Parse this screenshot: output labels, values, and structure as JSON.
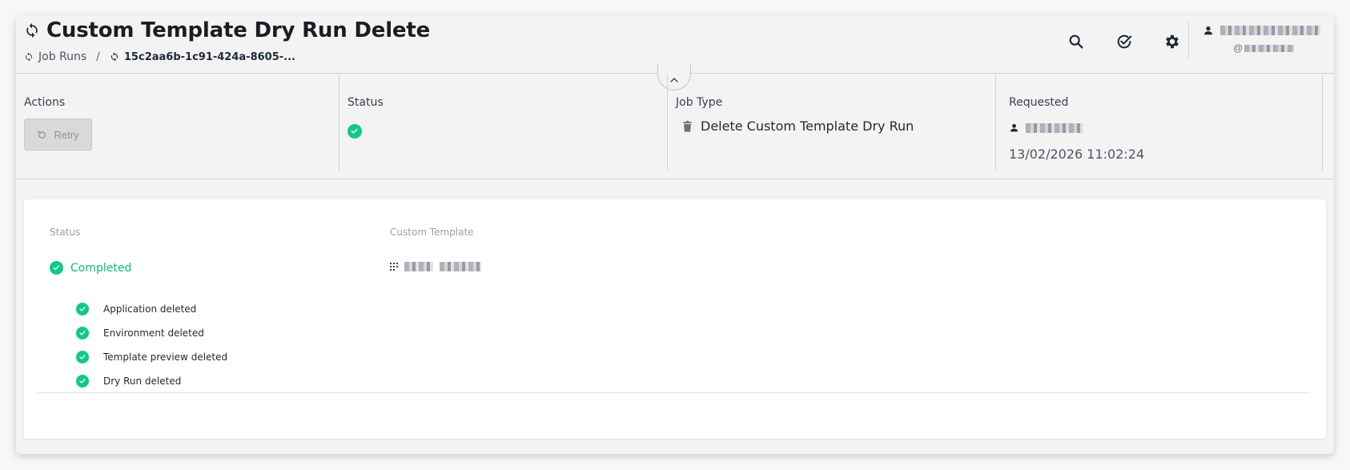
{
  "header": {
    "title": "Custom Template Dry Run Delete",
    "breadcrumb": [
      {
        "label": "Job Runs"
      },
      {
        "label": "15c2aa6b-1c91-424a-8605-..."
      }
    ],
    "separator": "/",
    "icons": [
      "sync-icon",
      "search-icon",
      "check-circle-icon",
      "gear-icon",
      "user-icon"
    ],
    "user_handle_prefix": "@"
  },
  "info": {
    "actions_label": "Actions",
    "retry_label": "Retry",
    "status_label": "Status",
    "job_type_label": "Job Type",
    "job_type_value": "Delete Custom Template Dry Run",
    "requested_label": "Requested",
    "requested_date": "13/02/2026 11:02:24"
  },
  "details": {
    "status_label": "Status",
    "status_value": "Completed",
    "custom_template_label": "Custom Template",
    "steps": [
      {
        "label": "Application deleted"
      },
      {
        "label": "Environment deleted"
      },
      {
        "label": "Template preview deleted"
      },
      {
        "label": "Dry Run deleted"
      }
    ]
  },
  "colors": {
    "success": "#10c987",
    "success_text": "#10b981",
    "panel_bg": "#f3f3f3",
    "card_bg": "#ffffff"
  }
}
